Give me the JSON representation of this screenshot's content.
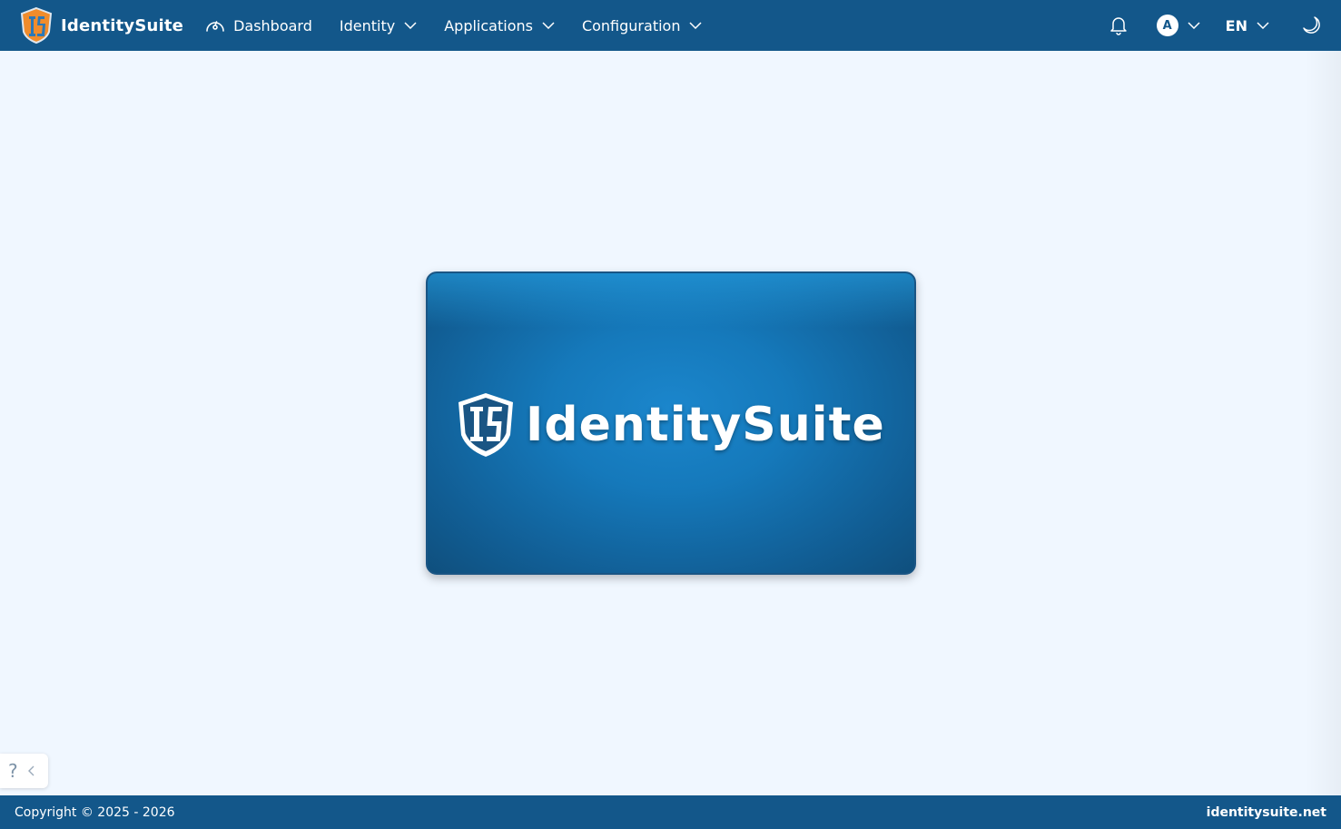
{
  "brand": {
    "name": "IdentitySuite",
    "logo_icon": "identitysuite-shield-logo",
    "logo_text": "IS"
  },
  "nav": {
    "dashboard": "Dashboard",
    "identity": "Identity",
    "applications": "Applications",
    "configuration": "Configuration"
  },
  "user": {
    "avatar_initial": "A"
  },
  "language": {
    "current": "EN"
  },
  "hero": {
    "title": "IdentitySuite",
    "logo_text": "IS"
  },
  "help": {
    "label": "?"
  },
  "footer": {
    "copyright": "Copyright © 2025 - 2026",
    "link": "identitysuite.net"
  },
  "colors": {
    "navbar": "#13578a",
    "background": "#f0f7ff",
    "hero": "#1579bb",
    "logo_orange": "#f08c2c"
  }
}
